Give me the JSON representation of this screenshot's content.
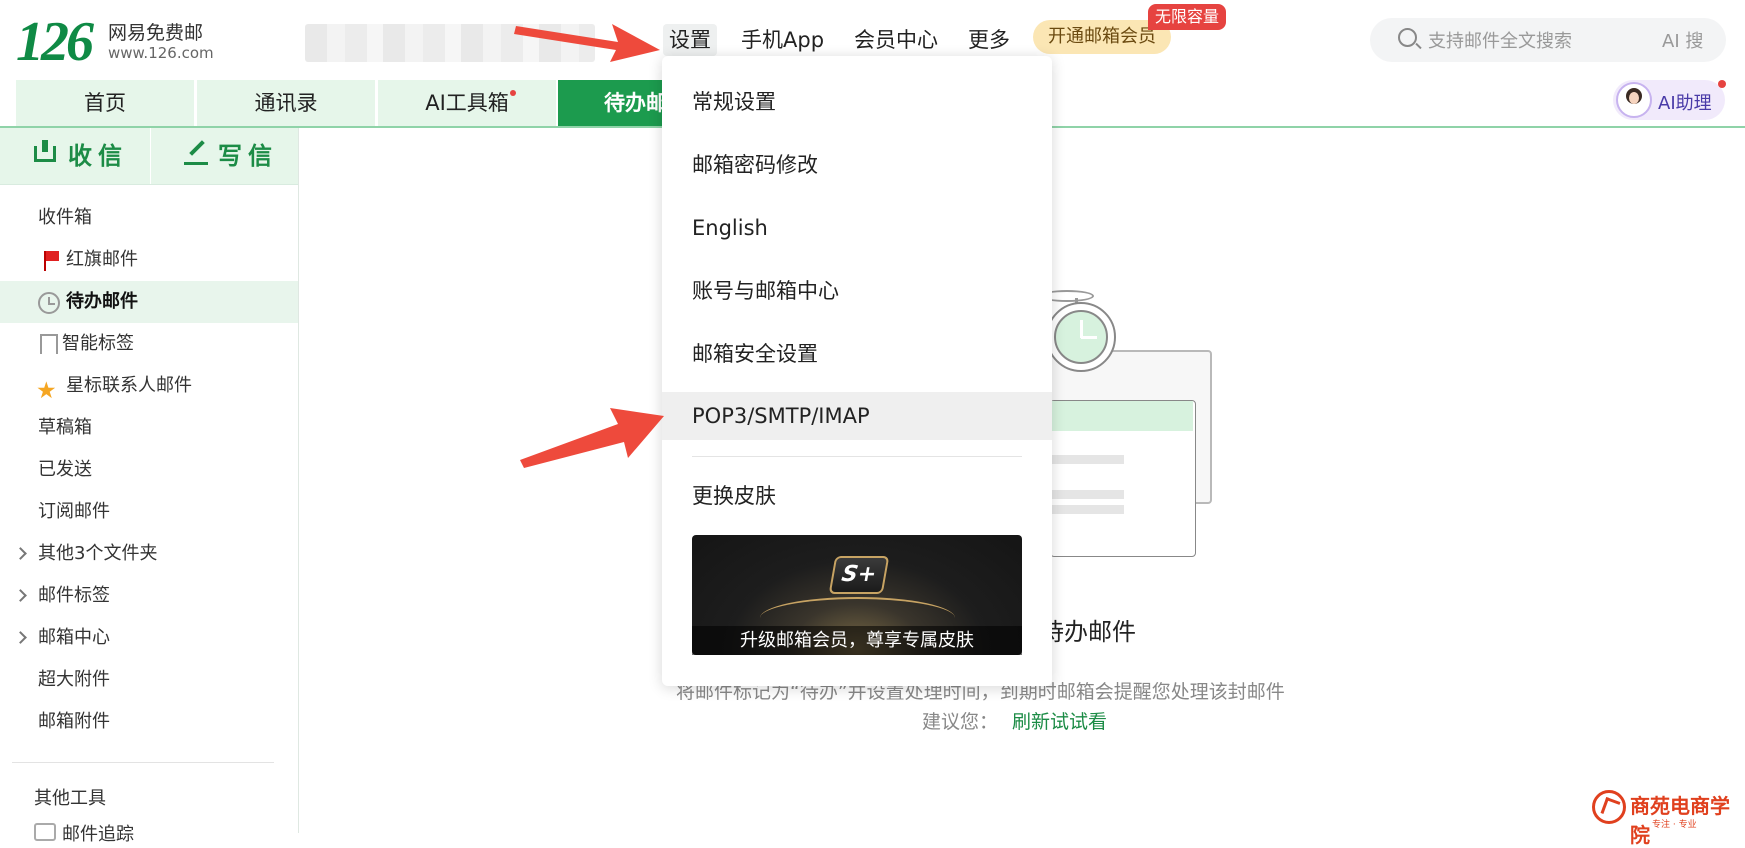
{
  "logo": {
    "number": "126",
    "name": "网易免费邮",
    "url": "www.126.com"
  },
  "topnav": {
    "settings": "设置",
    "app": "手机App",
    "vip_center": "会员中心",
    "more": "更多"
  },
  "vip": {
    "button": "开通邮箱会员",
    "badge": "无限容量"
  },
  "search": {
    "placeholder": "支持邮件全文搜索",
    "ai_search": "AI 搜"
  },
  "tabs": [
    {
      "label": "首页"
    },
    {
      "label": "通讯录"
    },
    {
      "label": "AI工具箱"
    },
    {
      "label": "待办邮"
    }
  ],
  "ai_assistant": {
    "label": "AI助理"
  },
  "sidebar": {
    "receive": "收信",
    "write": "写信",
    "folders": [
      {
        "label": "收件箱"
      },
      {
        "label": "红旗邮件",
        "icon": "flag-icon"
      },
      {
        "label": "待办邮件",
        "icon": "clock-icon"
      },
      {
        "label": "智能标签",
        "icon": "tag-icon"
      },
      {
        "label": "星标联系人邮件",
        "icon": "star-icon"
      },
      {
        "label": "草稿箱"
      },
      {
        "label": "已发送"
      },
      {
        "label": "订阅邮件"
      },
      {
        "label": "其他3个文件夹"
      },
      {
        "label": "邮件标签"
      },
      {
        "label": "邮箱中心"
      },
      {
        "label": "超大附件"
      },
      {
        "label": "邮箱附件"
      }
    ],
    "other_tools": "其他工具",
    "next_item": "邮件追踪"
  },
  "settings_menu": {
    "items": [
      {
        "label": "常规设置"
      },
      {
        "label": "邮箱密码修改"
      },
      {
        "label": "English"
      },
      {
        "label": "账号与邮箱中心"
      },
      {
        "label": "邮箱安全设置"
      },
      {
        "label": "POP3/SMTP/IMAP"
      }
    ],
    "skin": "更换皮肤",
    "skin_banner_logo": "S+",
    "skin_banner_caption": "升级邮箱会员，尊享专属皮肤"
  },
  "empty_state": {
    "title": "待办邮件",
    "description": "将邮件标记为“待办”并设置处理时间，到期时邮箱会提醒您处理该封邮件",
    "suggest": "建议您：",
    "refresh": "刷新试试看"
  },
  "watermark": {
    "text": "商苑电商学院",
    "sub": "专注 · 专业"
  },
  "colors": {
    "brand_green": "#1c9b4e",
    "tab_bg": "#e6f6ea",
    "arrow_red": "#ee4a3c",
    "badge_red": "#e64340"
  }
}
